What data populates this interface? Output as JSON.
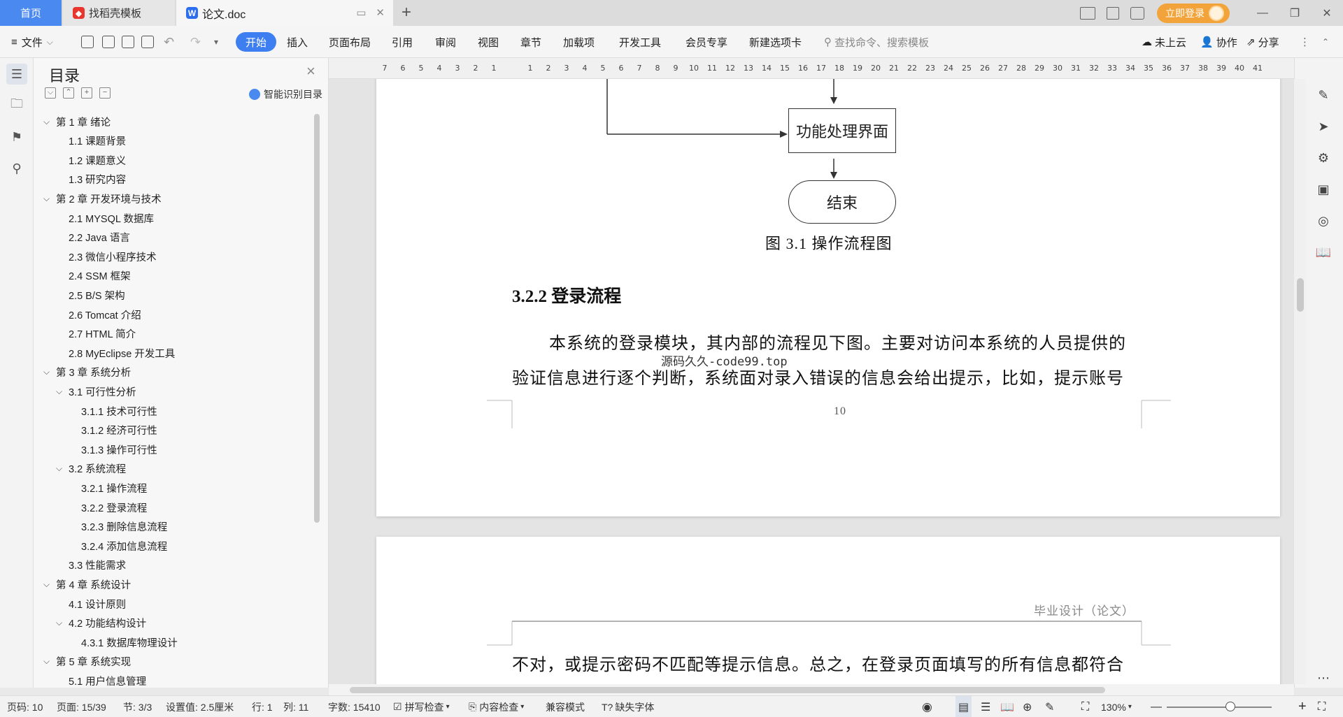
{
  "tabs": {
    "home": "首页",
    "daoke": "找稻壳模板",
    "doc": "论文.doc"
  },
  "title_right": {
    "login": "立即登录"
  },
  "ribbon": {
    "file": "文件",
    "start": "开始",
    "insert": "插入",
    "layout": "页面布局",
    "reference": "引用",
    "review": "审阅",
    "view": "视图",
    "section": "章节",
    "addons": "加载项",
    "devtools": "开发工具",
    "member": "会员专享",
    "new_tab": "新建选项卡",
    "search_placeholder": "查找命令、搜索模板",
    "cloud": "未上云",
    "collab": "协作",
    "share": "分享"
  },
  "toc": {
    "title": "目录",
    "smart": "智能识别目录",
    "items": [
      {
        "label": "第 1 章  绪论",
        "arrow": "⌵"
      },
      {
        "label": "1.1  课题背景",
        "arrow": ""
      },
      {
        "label": "1.2  课题意义",
        "arrow": ""
      },
      {
        "label": "1.3  研究内容",
        "arrow": ""
      },
      {
        "label": "第 2 章  开发环境与技术",
        "arrow": "⌵"
      },
      {
        "label": "2.1 MYSQL 数据库",
        "arrow": ""
      },
      {
        "label": "2.2 Java 语言",
        "arrow": ""
      },
      {
        "label": "2.3  微信小程序技术",
        "arrow": ""
      },
      {
        "label": "2.4 SSM 框架",
        "arrow": ""
      },
      {
        "label": "2.5 B/S 架构",
        "arrow": ""
      },
      {
        "label": "2.6 Tomcat  介绍",
        "arrow": ""
      },
      {
        "label": "2.7 HTML 简介",
        "arrow": ""
      },
      {
        "label": "2.8 MyEclipse 开发工具",
        "arrow": ""
      },
      {
        "label": "第 3 章  系统分析",
        "arrow": "⌵"
      },
      {
        "label": "3.1  可行性分析",
        "arrow": "⌵"
      },
      {
        "label": "3.1.1  技术可行性",
        "arrow": ""
      },
      {
        "label": "3.1.2  经济可行性",
        "arrow": ""
      },
      {
        "label": "3.1.3  操作可行性",
        "arrow": ""
      },
      {
        "label": "3.2  系统流程",
        "arrow": "⌵"
      },
      {
        "label": "3.2.1  操作流程",
        "arrow": ""
      },
      {
        "label": "3.2.2  登录流程",
        "arrow": ""
      },
      {
        "label": "3.2.3  删除信息流程",
        "arrow": ""
      },
      {
        "label": "3.2.4  添加信息流程",
        "arrow": ""
      },
      {
        "label": "3.3  性能需求",
        "arrow": ""
      },
      {
        "label": "第 4 章  系统设计",
        "arrow": "⌵"
      },
      {
        "label": "4.1  设计原则",
        "arrow": ""
      },
      {
        "label": "4.2  功能结构设计",
        "arrow": "⌵"
      },
      {
        "label": "4.3.1  数据库物理设计",
        "arrow": ""
      },
      {
        "label": "第 5 章  系统实现",
        "arrow": "⌵"
      },
      {
        "label": "5.1 用户信息管理",
        "arrow": ""
      }
    ]
  },
  "ruler": [
    "7",
    "6",
    "5",
    "4",
    "3",
    "2",
    "1",
    "",
    "1",
    "2",
    "3",
    "4",
    "5",
    "6",
    "7",
    "8",
    "9",
    "10",
    "11",
    "12",
    "13",
    "14",
    "15",
    "16",
    "17",
    "18",
    "19",
    "20",
    "21",
    "22",
    "23",
    "24",
    "25",
    "26",
    "27",
    "28",
    "29",
    "30",
    "31",
    "32",
    "33",
    "34",
    "35",
    "36",
    "37",
    "38",
    "39",
    "40",
    "41"
  ],
  "document": {
    "flow_box": "功能处理界面",
    "flow_end": "结束",
    "figure_caption": "图 3.1  操作流程图",
    "heading": "3.2.2  登录流程",
    "para_line1": "本系统的登录模块，其内部的流程见下图。主要对访问本系统的人员提供的",
    "watermark": "源码久久-code99.top",
    "para_line2": "验证信息进行逐个判断，系统面对录入错误的信息会给出提示，比如，提示账号",
    "page_number": "10",
    "page_header": "毕业设计（论文）",
    "para_line3": "不对，或提示密码不匹配等提示信息。总之，在登录页面填写的所有信息都符合"
  },
  "status": {
    "page_code": "页码: 10",
    "page": "页面: 15/39",
    "section": "节: 3/3",
    "setting": "设置值: 2.5厘米",
    "row": "行: 1",
    "col": "列: 11",
    "words": "字数: 15410",
    "spell": "拼写检查",
    "content_check": "内容检查",
    "compat": "兼容模式",
    "missing_font": "缺失字体",
    "zoom": "130%"
  },
  "colors": {
    "accent": "#3d7ff0",
    "login": "#f2a33a"
  }
}
